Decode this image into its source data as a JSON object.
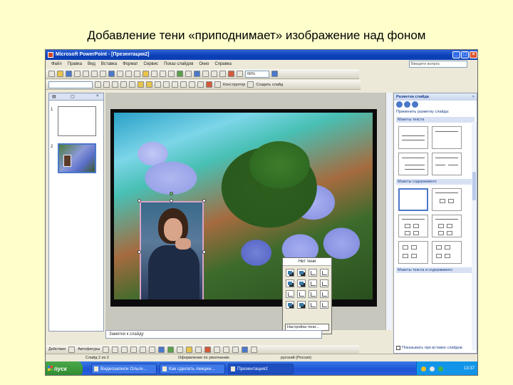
{
  "heading": "Добавление тени «приподнимает» изображение над фоном",
  "window": {
    "title": "Microsoft PowerPoint - [Презентация2]"
  },
  "menu": [
    "Файл",
    "Правка",
    "Вид",
    "Вставка",
    "Формат",
    "Сервис",
    "Показ слайдов",
    "Окно",
    "Справка"
  ],
  "help_box": "Введите вопрос",
  "toolbar": {
    "zoom": "66%",
    "designer": "Конструктор",
    "create_slide": "Создать слайд"
  },
  "left_pane": {
    "slide_numbers": [
      "1",
      "2"
    ]
  },
  "notes_placeholder": "Заметки к слайду",
  "shadow_popup": {
    "title": "Нет тени",
    "settings_button": "Настройка тени..."
  },
  "task_pane": {
    "title": "Разметка слайда",
    "apply_label": "Применить разметку слайда:",
    "section_text": "Макеты текста",
    "section_content": "Макеты содержимого",
    "section_text_content": "Макеты текста и содержимого",
    "show_on_insert": "Показывать при вставке слайдов"
  },
  "drawbar": {
    "actions": "Действия",
    "autoshapes": "Автофигуры"
  },
  "status": {
    "slide": "Слайд 2 из 2",
    "design": "Оформление по умолчанию",
    "language": "русский (Россия)"
  },
  "taskbar": {
    "start": "пуск",
    "tasks": [
      "Видеозаписи Ольги...",
      "Как сделать лекции...",
      "Презентация2"
    ],
    "clock": "13:37"
  }
}
